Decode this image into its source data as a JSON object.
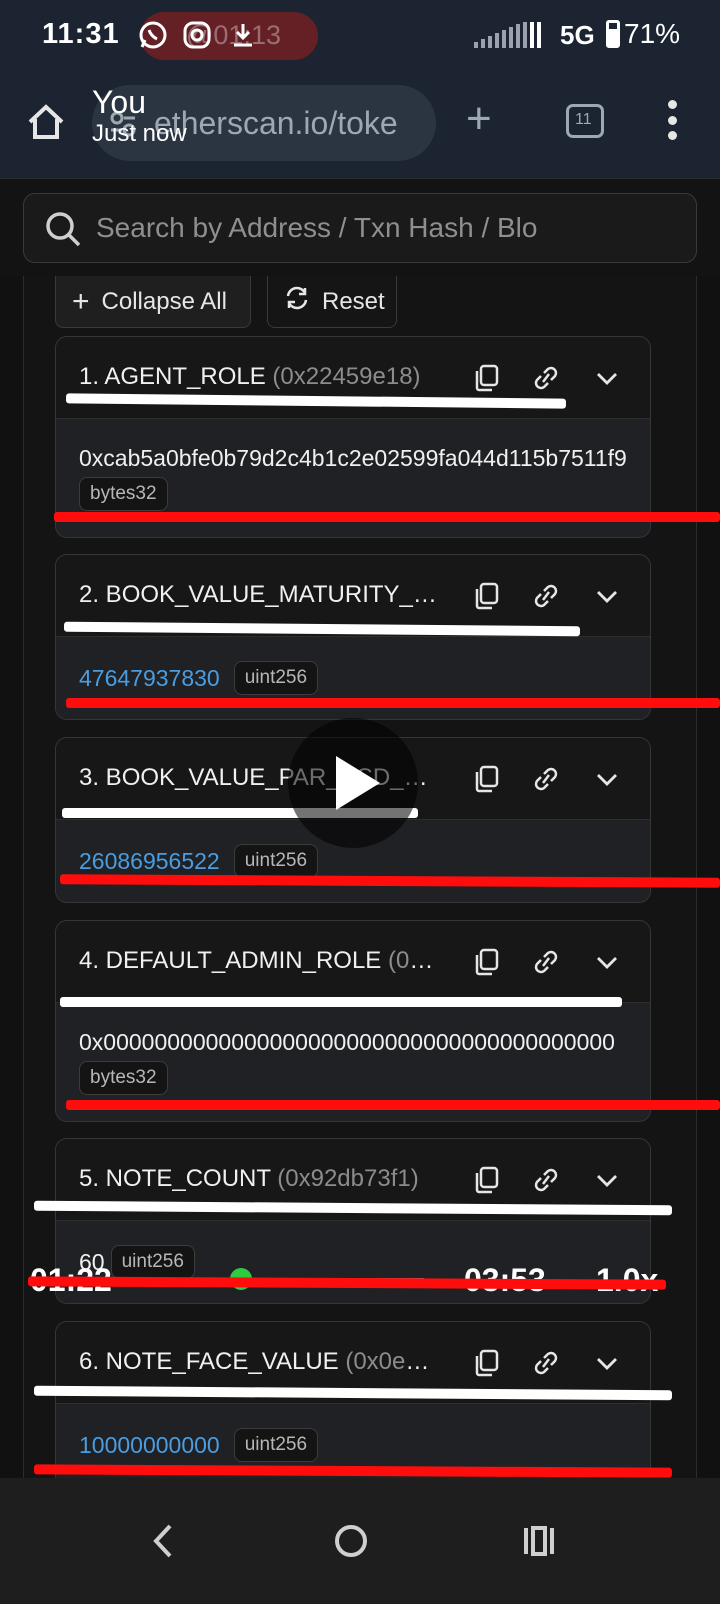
{
  "status_bar": {
    "time": "11:31",
    "pill_text": "@01:13",
    "network": "5G",
    "battery_percent": "71%",
    "battery_level": 0.71
  },
  "browser": {
    "url": "etherscan.io/toke",
    "tab_count": "11",
    "shared_by": "You",
    "shared_time": "Just now"
  },
  "search": {
    "placeholder": "Search by Address / Txn Hash / Blo"
  },
  "actions": {
    "collapse_label": "Collapse All",
    "reset_label": "Reset"
  },
  "functions": [
    {
      "name": "1. AGENT_ROLE",
      "signature": "(0x22459e18)",
      "value": "0xcab5a0bfe0b79d2c4b1c2e02599fa044d115b7511f9",
      "type": "bytes32"
    },
    {
      "name": "2. BOOK_VALUE_MATURITY_U...",
      "signature": "",
      "value": "47647937830",
      "type": "uint256"
    },
    {
      "name": "3. BOOK_VALUE_PAR_USD_PE...",
      "signature": "",
      "value": "26086956522",
      "type": "uint256"
    },
    {
      "name": "4. DEFAULT_ADMIN_ROLE",
      "signature": "(0xa...",
      "value": "0x0000000000000000000000000000000000000000",
      "type": "bytes32"
    },
    {
      "name": "5. NOTE_COUNT",
      "signature": "(0x92db73f1)",
      "value": "60",
      "type": "uint256"
    },
    {
      "name": "6. NOTE_FACE_VALUE",
      "signature": "(0x0e25...",
      "value": "10000000000",
      "type": "uint256"
    }
  ],
  "video": {
    "elapsed": "01:22",
    "total": "03:53",
    "speed": "1.0x"
  },
  "colors": {
    "annotation_red": "#ff0d0d",
    "annotation_white": "#ffffff",
    "value_link": "#4a9de0"
  }
}
